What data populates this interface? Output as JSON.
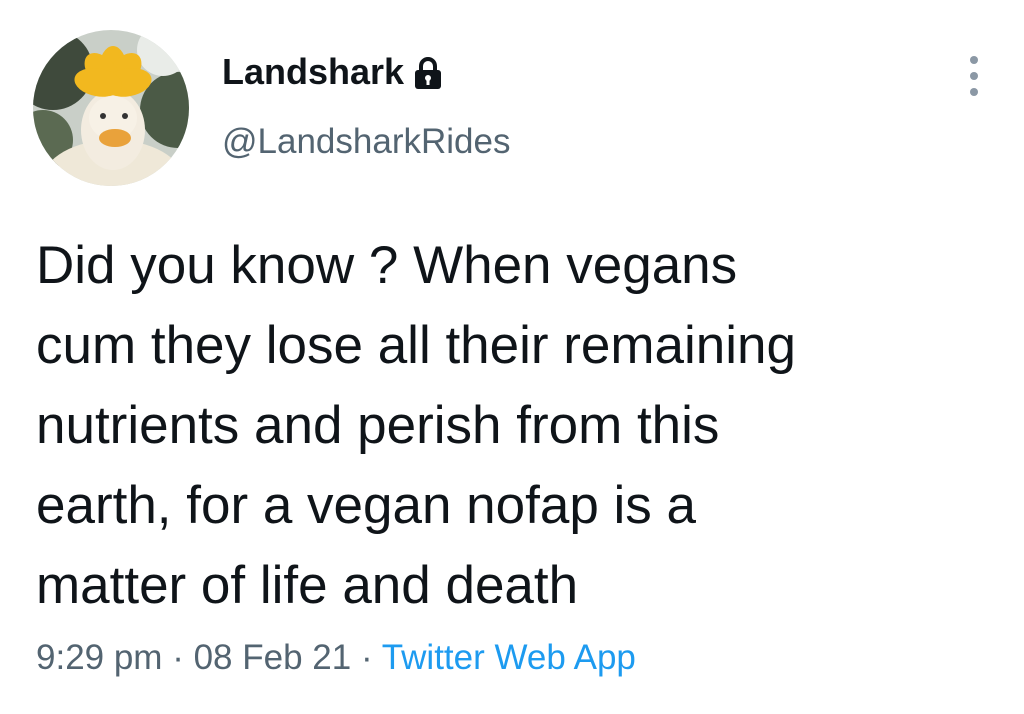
{
  "author": {
    "display_name": "Landshark",
    "handle": "@LandsharkRides",
    "avatar_icon": "duck-with-sunflower-avatar",
    "protected_icon": "lock-icon"
  },
  "tweet": {
    "text_lines": [
      "Did you know ?  When vegans",
      "cum they lose all their remaining",
      "nutrients and perish from this",
      "earth, for a vegan nofap is a",
      "matter of life and death"
    ],
    "time": "9:29 pm",
    "date": "08 Feb 21",
    "source": "Twitter Web App",
    "separator": "·"
  },
  "colors": {
    "text_primary": "#0f1419",
    "text_secondary": "#536471",
    "link": "#1d9bf0"
  },
  "more_icon": "more-vertical-icon"
}
